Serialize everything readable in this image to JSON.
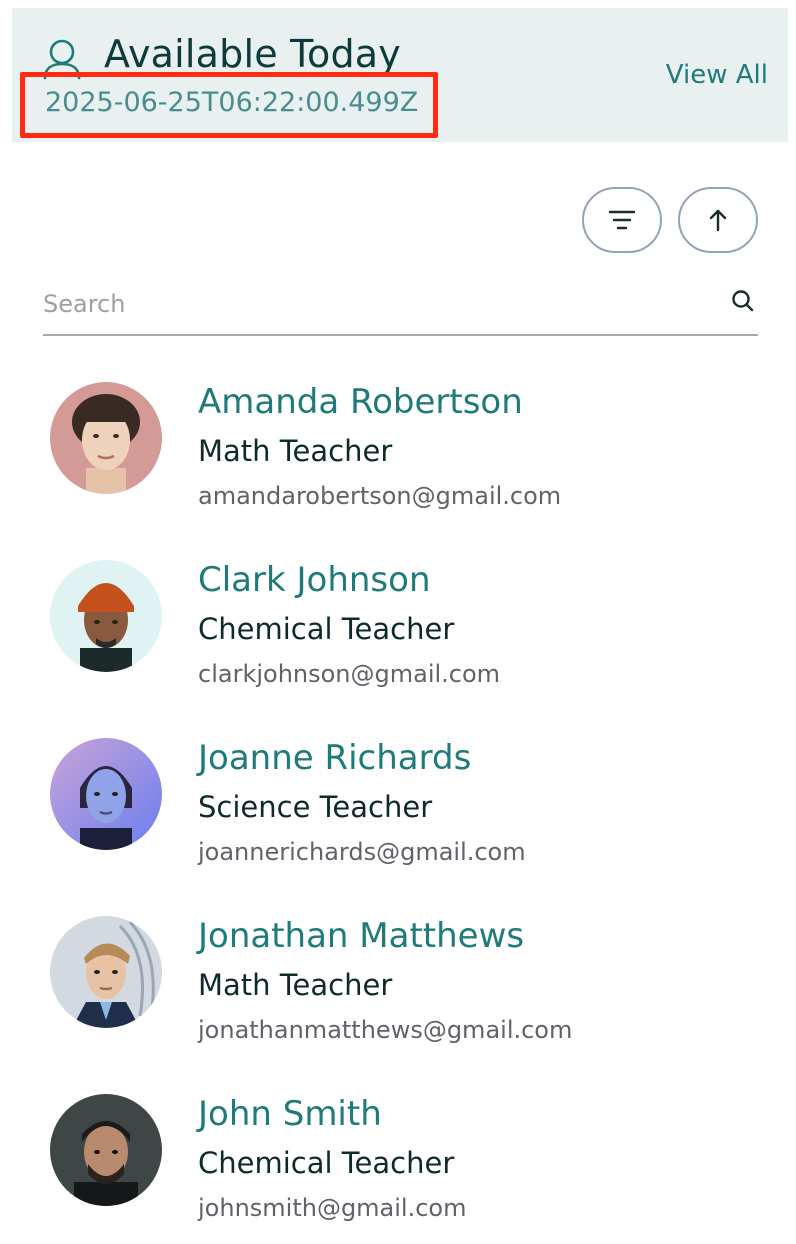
{
  "header": {
    "title": "Available Today",
    "timestamp": "2025-06-25T06:22:00.499Z",
    "view_all": "View All",
    "icon": "user-icon"
  },
  "toolbar": {
    "filter_icon": "filter-icon",
    "sort_icon": "arrow-up-icon"
  },
  "search": {
    "placeholder": "Search",
    "value": "",
    "icon": "search-icon"
  },
  "teachers": [
    {
      "name": "Amanda Robertson",
      "role": "Math Teacher",
      "email": "amandarobertson@gmail.com"
    },
    {
      "name": "Clark Johnson",
      "role": "Chemical Teacher",
      "email": "clarkjohnson@gmail.com"
    },
    {
      "name": "Joanne Richards",
      "role": "Science Teacher",
      "email": "joannerichards@gmail.com"
    },
    {
      "name": "Jonathan Matthews",
      "role": "Math Teacher",
      "email": "jonathanmatthews@gmail.com"
    },
    {
      "name": "John Smith",
      "role": "Chemical Teacher",
      "email": "johnsmith@gmail.com"
    }
  ],
  "colors": {
    "accent": "#1f7a7a",
    "header_bg": "#e8f0f0",
    "highlight_border": "#ff2b12"
  }
}
